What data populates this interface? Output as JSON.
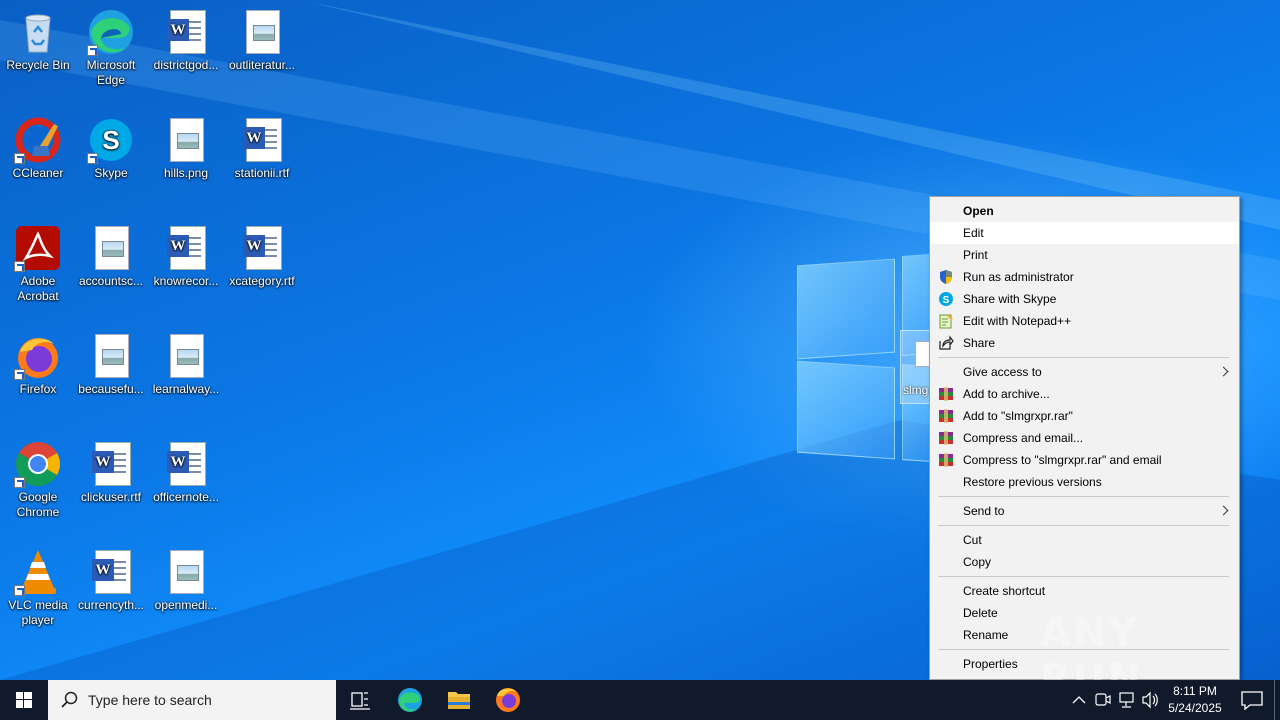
{
  "desktop": {
    "icons": [
      {
        "name": "recycle-bin",
        "label": "Recycle Bin"
      },
      {
        "name": "microsoft-edge",
        "label": "Microsoft Edge"
      },
      {
        "name": "districtgod",
        "label": "districtgod..."
      },
      {
        "name": "outliteratur",
        "label": "outliteratur..."
      },
      {
        "name": "ccleaner",
        "label": "CCleaner"
      },
      {
        "name": "skype",
        "label": "Skype"
      },
      {
        "name": "hills",
        "label": "hills.png"
      },
      {
        "name": "stationii",
        "label": "stationii.rtf"
      },
      {
        "name": "adobe-acrobat",
        "label": "Adobe Acrobat"
      },
      {
        "name": "accountsc",
        "label": "accountsc..."
      },
      {
        "name": "knowrecor",
        "label": "knowrecor..."
      },
      {
        "name": "xcategory",
        "label": "xcategory.rtf"
      },
      {
        "name": "firefox",
        "label": "Firefox"
      },
      {
        "name": "becausefu",
        "label": "becausefu..."
      },
      {
        "name": "learnalway",
        "label": "learnalway..."
      },
      {
        "name": "google-chrome",
        "label": "Google Chrome"
      },
      {
        "name": "clickuser",
        "label": "clickuser.rtf"
      },
      {
        "name": "officernote",
        "label": "officernote..."
      },
      {
        "name": "vlc",
        "label": "VLC media player"
      },
      {
        "name": "currencyth",
        "label": "currencyth..."
      },
      {
        "name": "openmedi",
        "label": "openmedi..."
      },
      {
        "name": "selected-file",
        "label": "slmg"
      }
    ]
  },
  "context_menu": {
    "items": [
      {
        "label": "Open"
      },
      {
        "label": "Edit"
      },
      {
        "label": "Print"
      },
      {
        "label": "Run as administrator"
      },
      {
        "label": "Share with Skype"
      },
      {
        "label": "Edit with Notepad++"
      },
      {
        "label": "Share"
      },
      {
        "label": "Give access to"
      },
      {
        "label": "Add to archive..."
      },
      {
        "label": "Add to \"slmgrxpr.rar\""
      },
      {
        "label": "Compress and email..."
      },
      {
        "label": "Compress to \"slmgrxpr.rar\" and email"
      },
      {
        "label": "Restore previous versions"
      },
      {
        "label": "Send to"
      },
      {
        "label": "Cut"
      },
      {
        "label": "Copy"
      },
      {
        "label": "Create shortcut"
      },
      {
        "label": "Delete"
      },
      {
        "label": "Rename"
      },
      {
        "label": "Properties"
      }
    ]
  },
  "taskbar": {
    "search_placeholder": "Type here to search",
    "time": "8:11 PM",
    "date": "5/24/2025"
  },
  "watermark": "ANY RUN"
}
